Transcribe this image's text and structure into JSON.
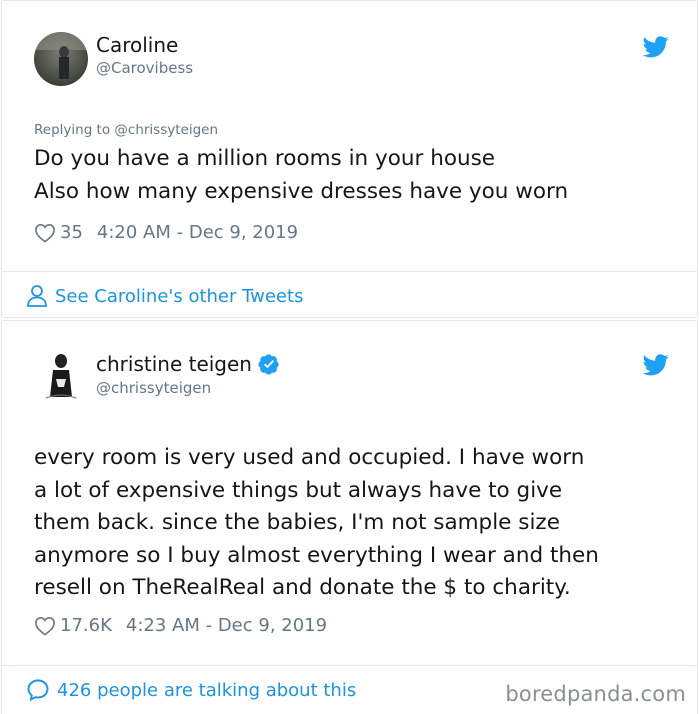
{
  "tweet1": {
    "name": "Caroline",
    "handle": "@Carovibess",
    "replying_to": "Replying to @chrissyteigen",
    "lines": [
      "Do you have a million rooms in your house",
      "Also how many expensive dresses have you worn"
    ],
    "likes": "35",
    "timestamp": "4:20 AM - Dec 9, 2019",
    "footer_link": "See Caroline's other Tweets"
  },
  "tweet2": {
    "name": "christine teigen",
    "verified": true,
    "handle": "@chrissyteigen",
    "lines": [
      "every room is very used and occupied. I have worn",
      "a lot of expensive things but always have to give",
      "them back. since the babies, I'm not sample size",
      "anymore so I buy almost everything I wear and then",
      "resell on TheRealReal and donate the $ to charity."
    ],
    "likes": "17.6K",
    "timestamp": "4:23 AM - Dec 9, 2019",
    "footer_link": "426 people are talking about this"
  },
  "watermark": "boredpanda.com",
  "colors": {
    "twitter_blue": "#1da1f2",
    "link_blue": "#1b95e0",
    "secondary_text": "#657786",
    "border": "#e1e8ed"
  },
  "icons": {
    "bird": "twitter-bird-icon",
    "heart": "heart-icon",
    "person": "person-icon",
    "comment": "comment-bubble-icon",
    "verified": "verified-badge-icon"
  }
}
